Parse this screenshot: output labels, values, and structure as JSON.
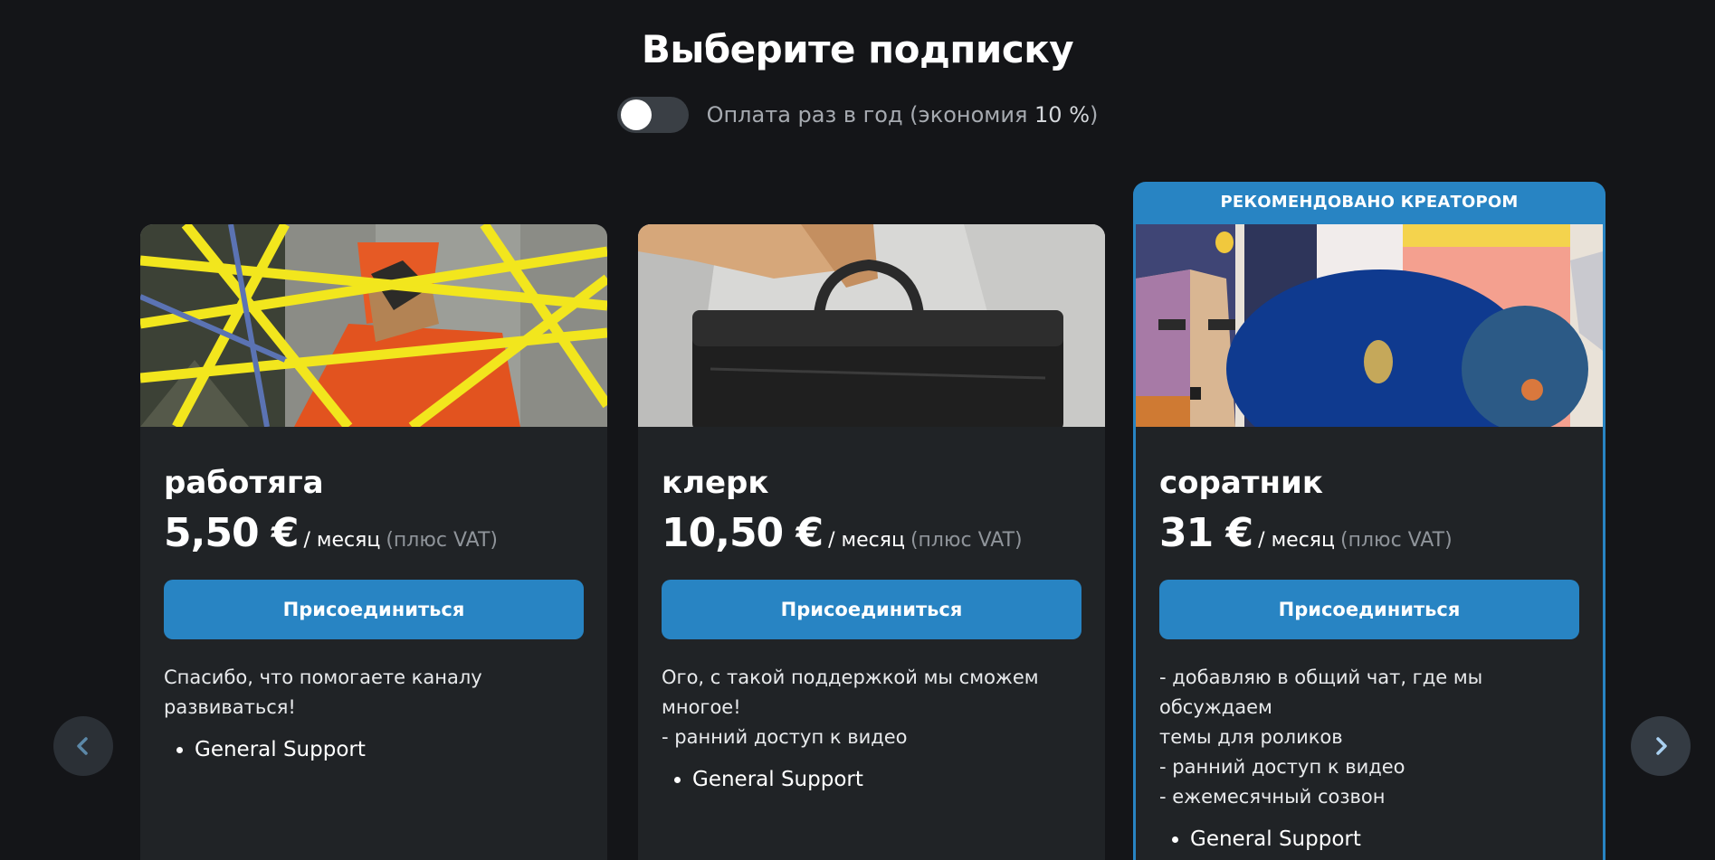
{
  "header": {
    "title": "Выберите подписку",
    "billing_toggle_label_pre": "Оплата раз в год (",
    "billing_toggle_label_mid": "экономия ",
    "billing_toggle_label_pct": "10 %",
    "billing_toggle_label_post": ")",
    "billing_toggle_on": false
  },
  "tiers": [
    {
      "name": "работяга",
      "price": "5,50 €",
      "period": "/ месяц",
      "vat": "(плюс VAT)",
      "button_label": "Присоединиться",
      "description": [
        "Спасибо, что помогаете каналу развиваться!"
      ],
      "benefits": [
        "General Support"
      ],
      "recommended": false
    },
    {
      "name": "клерк",
      "price": "10,50 €",
      "period": "/ месяц",
      "vat": "(плюс VAT)",
      "button_label": "Присоединиться",
      "description": [
        "Ого, с такой поддержкой мы сможем многое!",
        "- ранний доступ к видео"
      ],
      "benefits": [
        "General Support"
      ],
      "recommended": false
    },
    {
      "name": "соратник",
      "price": "31 €",
      "period": "/ месяц",
      "vat": "(плюс VAT)",
      "button_label": "Присоединиться",
      "banner": "РЕКОМЕНДОВАНО КРЕАТОРОМ",
      "description": [
        "- добавляю в общий чат, где мы обсуждаем",
        "темы для роликов",
        "- ранний доступ к видео",
        "- ежемесячный созвон"
      ],
      "benefits": [
        "General Support"
      ],
      "recommended": true
    }
  ],
  "navigation": {
    "prev_icon": "chevron-left-icon",
    "next_icon": "chevron-right-icon"
  },
  "colors": {
    "background": "#141518",
    "card": "#202326",
    "accent": "#2884c3"
  }
}
